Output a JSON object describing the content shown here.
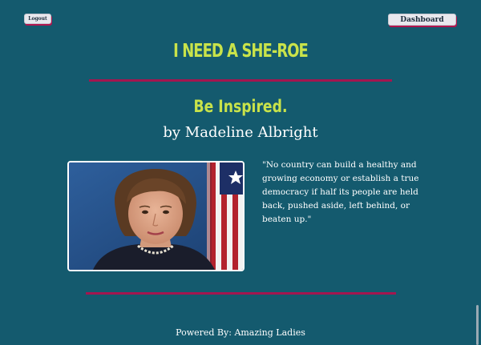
{
  "header": {
    "logout_label": "Logout",
    "dashboard_label": "Dashboard"
  },
  "site_title": "I NEED A SHE-ROE",
  "main": {
    "heading": "Be Inspired.",
    "byline": "by Madeline Albright",
    "quote": "\"No country can build a healthy and growing economy or establish a true democracy if half its people are held back, pushed aside, left behind, or beaten up.\""
  },
  "footer": {
    "powered_by_prefix": "Powered By:",
    "powered_by_name": "Amazing Ladies"
  },
  "colors": {
    "background": "#145a6e",
    "title_accent": "#c9e34a",
    "divider": "#a3164f",
    "text": "#ffffff",
    "button_bg": "#e8e8ee"
  }
}
